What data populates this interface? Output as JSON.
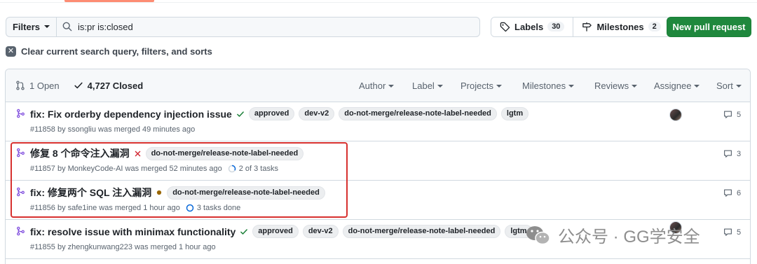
{
  "search": {
    "filters_label": "Filters",
    "query": "is:pr is:closed"
  },
  "labels_btn": {
    "label": "Labels",
    "count": "30"
  },
  "milestones_btn": {
    "label": "Milestones",
    "count": "2"
  },
  "new_pr_label": "New pull request",
  "clear_label": "Clear current search query, filters, and sorts",
  "header": {
    "open_label": "1 Open",
    "closed_label": "4,727 Closed",
    "filters": [
      "Author",
      "Label",
      "Projects",
      "Milestones",
      "Reviews",
      "Assignee",
      "Sort"
    ]
  },
  "rows": [
    {
      "title": "fix: Fix orderby dependency injection issue",
      "status": "check",
      "labels": [
        "approved",
        "dev-v2",
        "do-not-merge/release-note-label-needed",
        "lgtm"
      ],
      "meta": "#11858 by ssongliu was merged 49 minutes ago",
      "tasks": "",
      "comments": "5",
      "has_avatar": true
    },
    {
      "title": "修复 8 个命令注入漏洞",
      "status": "x",
      "labels": [
        "do-not-merge/release-note-label-needed"
      ],
      "meta": "#11857 by MonkeyCode-AI was merged 52 minutes ago",
      "tasks": "2 of 3 tasks",
      "comments": "3",
      "has_avatar": false
    },
    {
      "title": "fix: 修复两个 SQL 注入漏洞",
      "status": "pending",
      "labels": [
        "do-not-merge/release-note-label-needed"
      ],
      "meta": "#11856 by safe1ine was merged 1 hour ago",
      "tasks": "3 tasks done",
      "comments": "6",
      "has_avatar": false
    },
    {
      "title": "fix: resolve issue with minimax functionality",
      "status": "check",
      "labels": [
        "approved",
        "dev-v2",
        "do-not-merge/release-note-label-needed",
        "lgtm"
      ],
      "meta": "#11855 by zhengkunwang223 was merged 1 hour ago",
      "tasks": "",
      "comments": "5",
      "has_avatar": false
    }
  ],
  "watermark": "公众号 · GG学安全",
  "colors": {
    "merged": "#8250df",
    "success": "#1a7f37",
    "fail": "#d1242f",
    "pending": "#9a6700",
    "primary": "#1f883d",
    "highlight": "#d7312f"
  }
}
